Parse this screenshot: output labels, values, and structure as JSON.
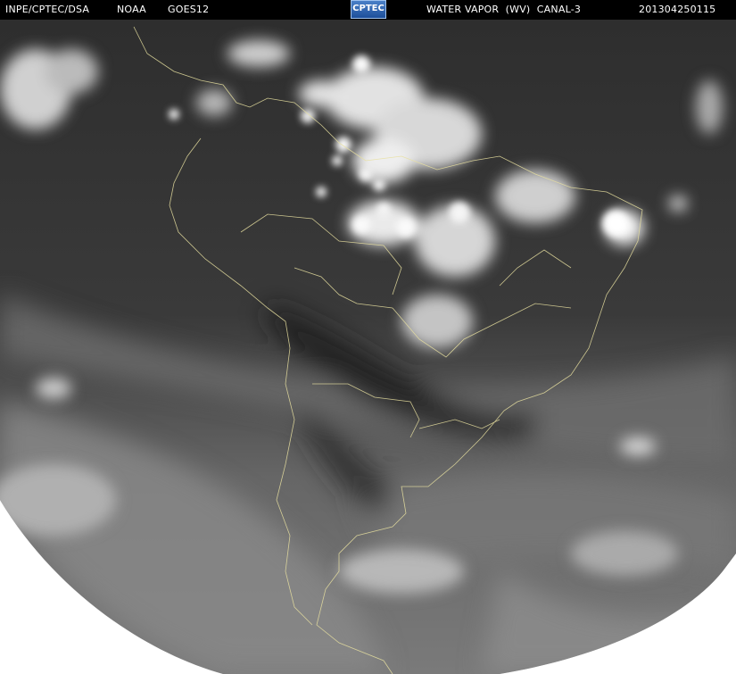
{
  "header": {
    "source": "INPE/CPTEC/DSA",
    "agency": "NOAA",
    "satellite": "GOES12",
    "logo": "CPTEC",
    "channel": "WATER VAPOR  (WV)  CANAL-3",
    "timestamp": "201304250115"
  },
  "colors": {
    "header_bg": "#000000",
    "header_text": "#ffffff",
    "page_bg": "#ffffff",
    "coastline": "#e8e0a0",
    "logo_bg": "#2a5fb0"
  }
}
